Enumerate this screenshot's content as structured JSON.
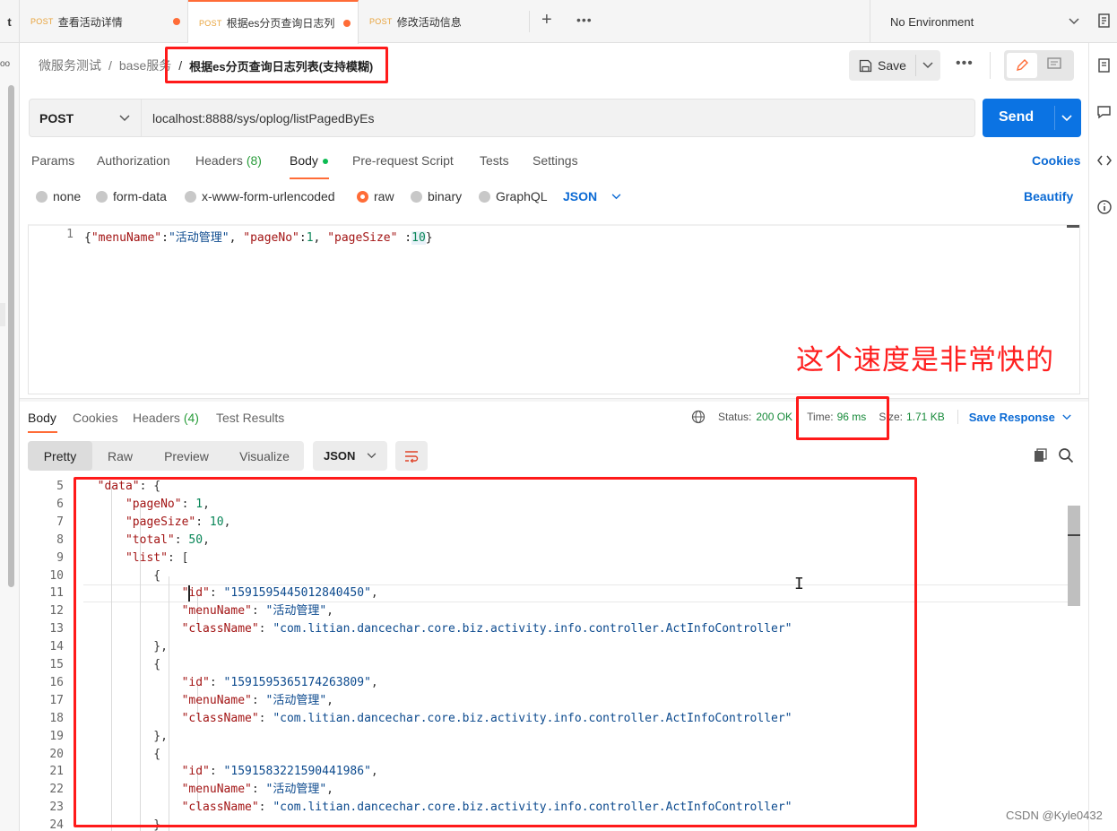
{
  "tabs": [
    {
      "method": "POST",
      "label": "查看活动详情",
      "unsaved": true
    },
    {
      "method": "POST",
      "label": "根据es分页查询日志列",
      "unsaved": true
    },
    {
      "method": "POST",
      "label": "修改活动信息",
      "unsaved": false
    }
  ],
  "tab_left_fragment": "t",
  "environment": "No Environment",
  "breadcrumb": {
    "root": "微服务测试",
    "sep": "/",
    "folder": "base服务",
    "current": "根据es分页查询日志列表(支持模糊)"
  },
  "header": {
    "save_label": "Save",
    "more_label": "•••"
  },
  "request": {
    "method": "POST",
    "url": "localhost:8888/sys/oplog/listPagedByEs",
    "send_label": "Send"
  },
  "request_tabs": {
    "params": "Params",
    "authorization": "Authorization",
    "headers": "Headers",
    "headers_count": "(8)",
    "body": "Body",
    "prerequest": "Pre-request Script",
    "tests": "Tests",
    "settings": "Settings",
    "cookies": "Cookies"
  },
  "body_types": {
    "none": "none",
    "form_data": "form-data",
    "urlencoded": "x-www-form-urlencoded",
    "raw": "raw",
    "binary": "binary",
    "graphql": "GraphQL",
    "format": "JSON",
    "beautify": "Beautify"
  },
  "request_body": {
    "line_no": "1",
    "k1": "\"menuName\"",
    "v1": "\"活动管理\"",
    "k2": "\"pageNo\"",
    "v2": "1",
    "k3": "\"pageSize\"",
    "v3": "10"
  },
  "annotation": "这个速度是非常快的",
  "response": {
    "tabs": {
      "body": "Body",
      "cookies": "Cookies",
      "headers": "Headers",
      "headers_count": "(4)",
      "test_results": "Test Results"
    },
    "status_label": "Status:",
    "status_value": "200 OK",
    "time_label": "Time:",
    "time_value": "96 ms",
    "size_label": "Size:",
    "size_value": "1.71 KB",
    "save_response": "Save Response",
    "views": {
      "pretty": "Pretty",
      "raw": "Raw",
      "preview": "Preview",
      "visualize": "Visualize"
    },
    "format": "JSON",
    "lines": [
      {
        "no": "5",
        "text": "  \"data\": {"
      },
      {
        "no": "6",
        "text": "      \"pageNo\": 1,"
      },
      {
        "no": "7",
        "text": "      \"pageSize\": 10,"
      },
      {
        "no": "8",
        "text": "      \"total\": 50,"
      },
      {
        "no": "9",
        "text": "      \"list\": ["
      },
      {
        "no": "10",
        "text": "          {"
      },
      {
        "no": "11",
        "text": "              \"id\": \"1591595445012840450\","
      },
      {
        "no": "12",
        "text": "              \"menuName\": \"活动管理\","
      },
      {
        "no": "13",
        "text": "              \"className\": \"com.litian.dancechar.core.biz.activity.info.controller.ActInfoController\""
      },
      {
        "no": "14",
        "text": "          },"
      },
      {
        "no": "15",
        "text": "          {"
      },
      {
        "no": "16",
        "text": "              \"id\": \"1591595365174263809\","
      },
      {
        "no": "17",
        "text": "              \"menuName\": \"活动管理\","
      },
      {
        "no": "18",
        "text": "              \"className\": \"com.litian.dancechar.core.biz.activity.info.controller.ActInfoController\""
      },
      {
        "no": "19",
        "text": "          },"
      },
      {
        "no": "20",
        "text": "          {"
      },
      {
        "no": "21",
        "text": "              \"id\": \"1591583221590441986\","
      },
      {
        "no": "22",
        "text": "              \"menuName\": \"活动管理\","
      },
      {
        "no": "23",
        "text": "              \"className\": \"com.litian.dancechar.core.biz.activity.info.controller.ActInfoController\""
      },
      {
        "no": "24",
        "text": "          }"
      }
    ]
  },
  "watermark": "CSDN @Kyle0432",
  "colors": {
    "accent": "#ff6c37",
    "send": "#0b73e3",
    "annotation": "#ff1f1f",
    "status_ok": "#178a3a"
  }
}
